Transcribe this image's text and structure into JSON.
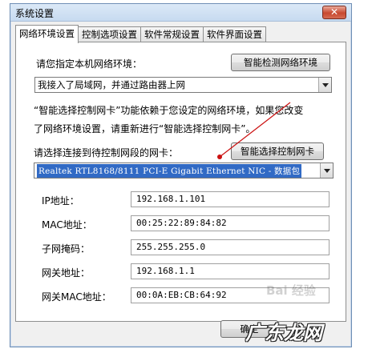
{
  "window": {
    "title": "系统设置",
    "close_glyph": "✕"
  },
  "tabs": [
    {
      "label": "网络环境设置",
      "active": true
    },
    {
      "label": "控制选项设置",
      "active": false
    },
    {
      "label": "软件常规设置",
      "active": false
    },
    {
      "label": "软件界面设置",
      "active": false
    }
  ],
  "network": {
    "specify_label": "请您指定本机网络环境：",
    "detect_button": "智能检测网络环境",
    "env_value": "我接入了局域网，并通过路由器上网",
    "notice_line1": "“智能选择控制网卡”功能依赖于您设定的网络环境，如果您改变",
    "notice_line2": "了网络环境设置，请重新进行“智能选择控制网卡”。",
    "nic_label": "请选择连接到待控制网段的网卡：",
    "select_nic_button": "智能选择控制网卡",
    "nic_value": "Realtek RTL8168/8111 PCI-E Gigabit Ethernet NIC - 数据包"
  },
  "fields": [
    {
      "label": "IP地址：",
      "value": "192.168.1.101"
    },
    {
      "label": "MAC地址：",
      "value": "00:25:22:89:84:82"
    },
    {
      "label": "子网掩码：",
      "value": "255.255.255.0"
    },
    {
      "label": "网关地址：",
      "value": "192.168.1.1"
    },
    {
      "label": "网关MAC地址：",
      "value": "00:0A:EB:CB:64:92"
    }
  ],
  "footer": {
    "ok_button": "确定"
  },
  "watermarks": {
    "baidu": "Bai 经验",
    "site": "广东龙网"
  },
  "colors": {
    "annotation_line": "#cc1111",
    "selection": "#316ac5"
  }
}
